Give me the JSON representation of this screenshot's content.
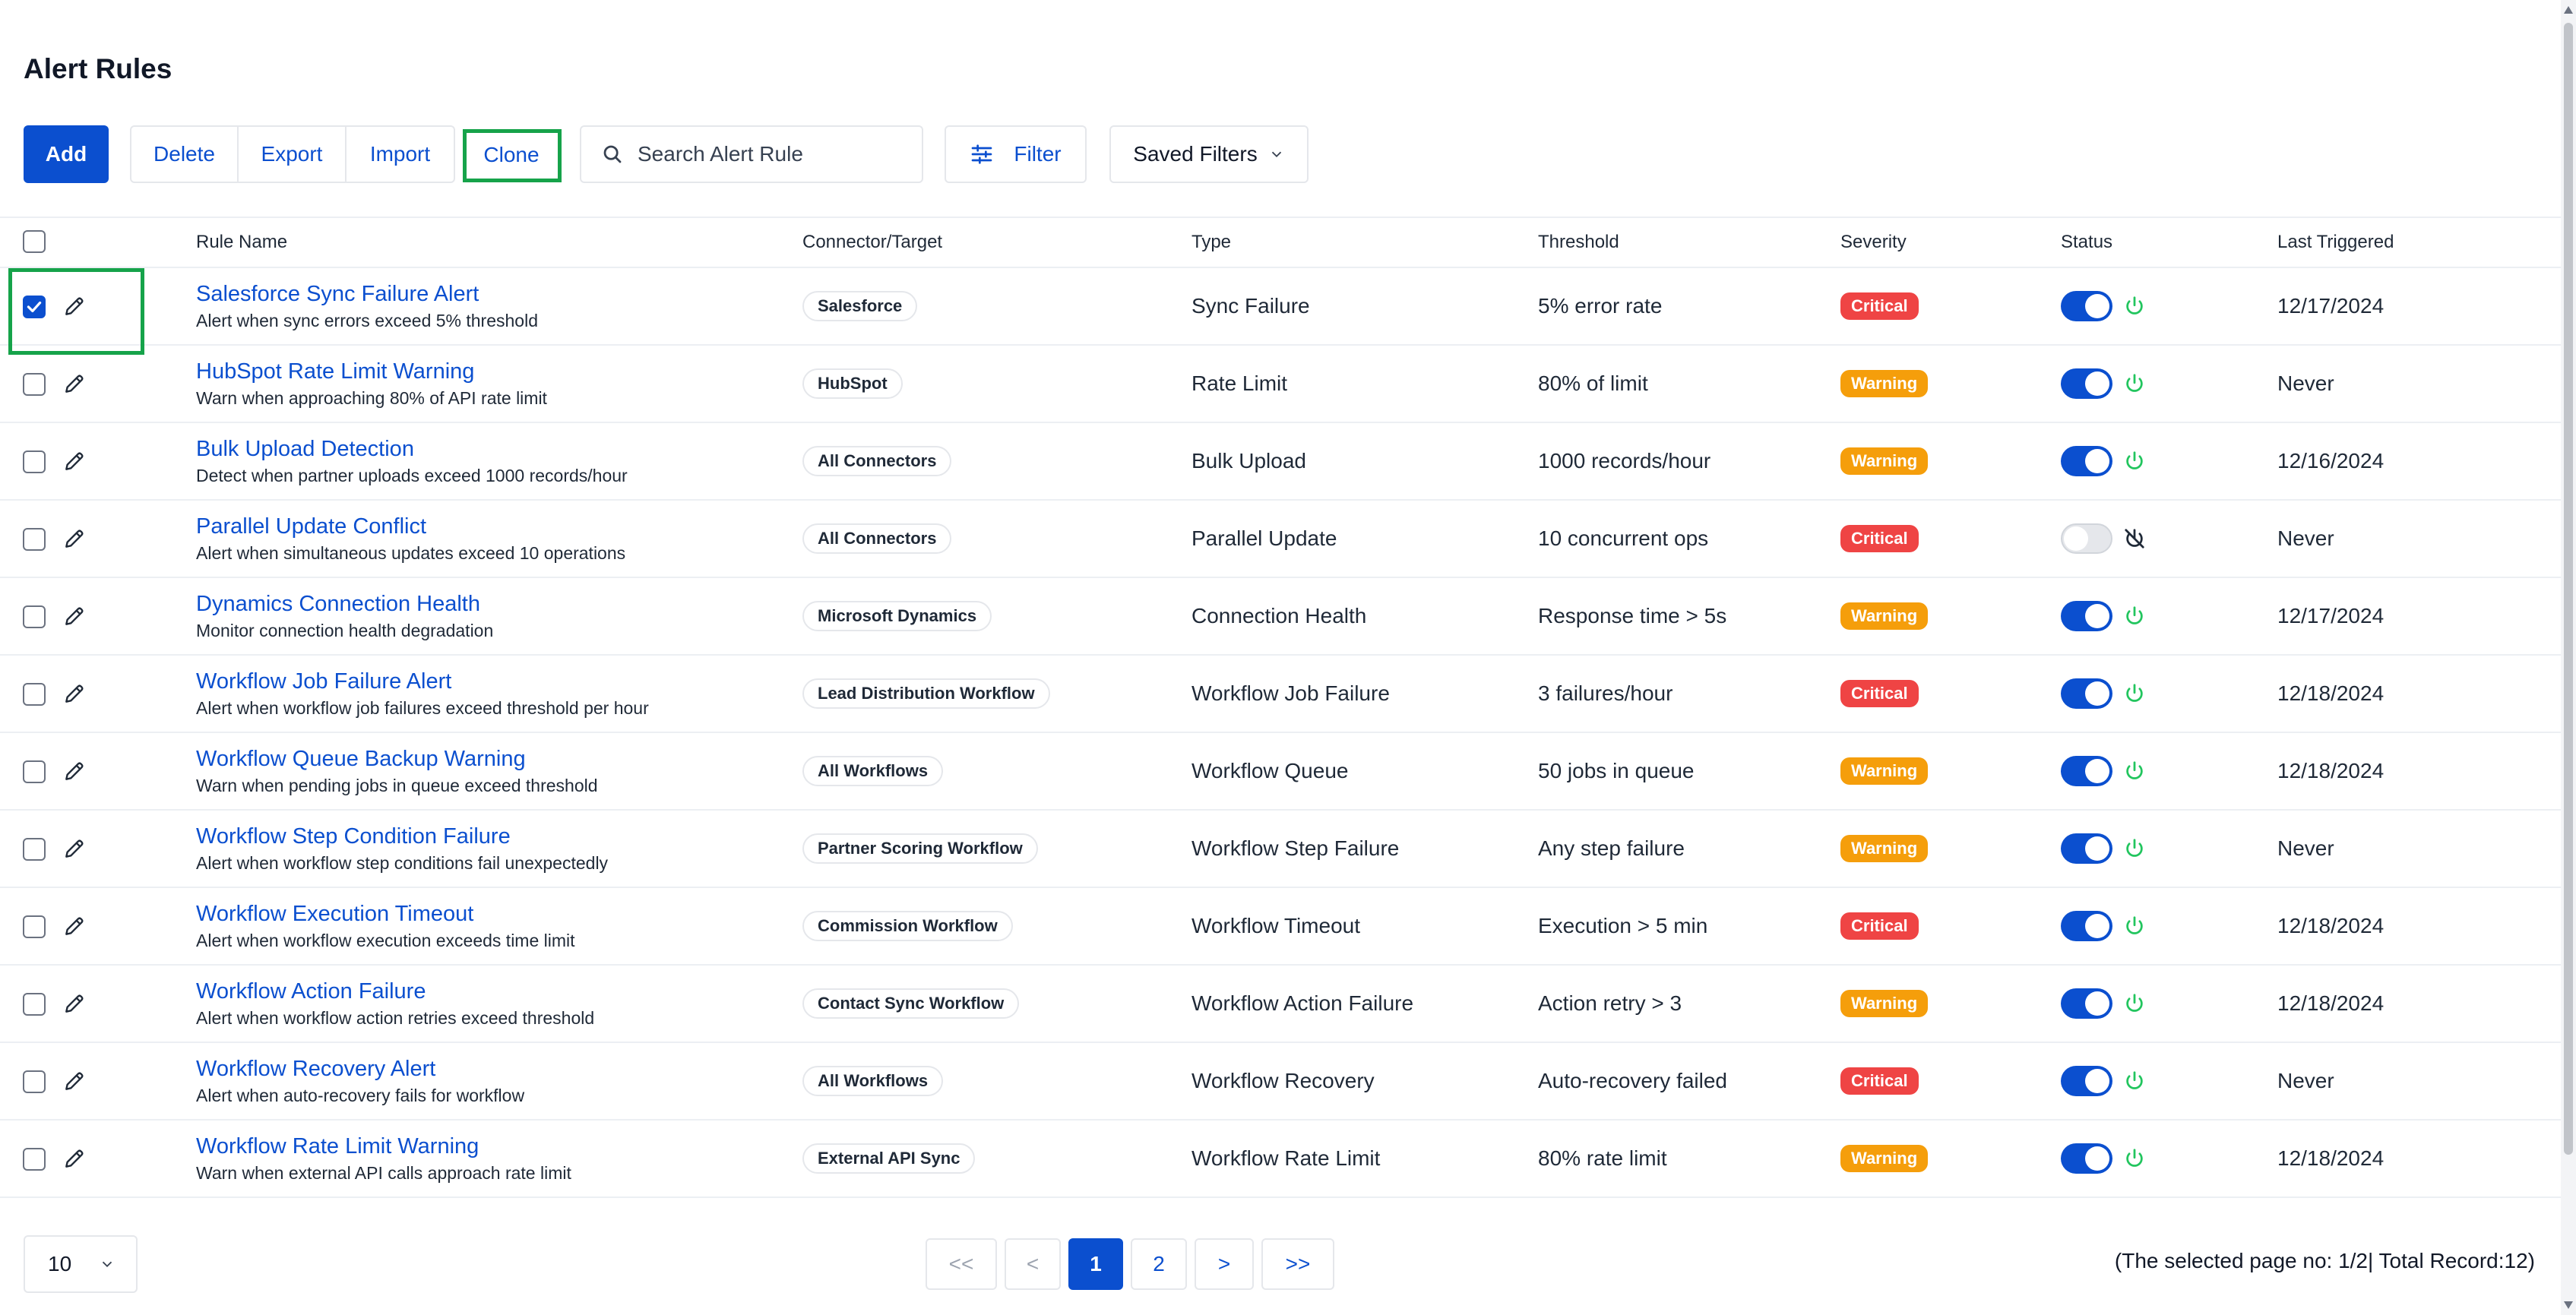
{
  "page": {
    "title": "Alert Rules"
  },
  "toolbar": {
    "add_label": "Add",
    "delete_label": "Delete",
    "export_label": "Export",
    "import_label": "Import",
    "clone_label": "Clone",
    "search_placeholder": "Search Alert Rule",
    "filter_label": "Filter",
    "saved_filters_label": "Saved Filters"
  },
  "table": {
    "columns": [
      "Rule Name",
      "Connector/Target",
      "Type",
      "Threshold",
      "Severity",
      "Status",
      "Last Triggered"
    ],
    "rows": [
      {
        "name": "Salesforce Sync Failure Alert",
        "description": "Alert when sync errors exceed 5% threshold",
        "connector": "Salesforce",
        "type": "Sync Failure",
        "threshold": "5% error rate",
        "severity": "Critical",
        "status_on": true,
        "last_triggered": "12/17/2024",
        "checked": true
      },
      {
        "name": "HubSpot Rate Limit Warning",
        "description": "Warn when approaching 80% of API rate limit",
        "connector": "HubSpot",
        "type": "Rate Limit",
        "threshold": "80% of limit",
        "severity": "Warning",
        "status_on": true,
        "last_triggered": "Never",
        "checked": false
      },
      {
        "name": "Bulk Upload Detection",
        "description": "Detect when partner uploads exceed 1000 records/hour",
        "connector": "All Connectors",
        "type": "Bulk Upload",
        "threshold": "1000 records/hour",
        "severity": "Warning",
        "status_on": true,
        "last_triggered": "12/16/2024",
        "checked": false
      },
      {
        "name": "Parallel Update Conflict",
        "description": "Alert when simultaneous updates exceed 10 operations",
        "connector": "All Connectors",
        "type": "Parallel Update",
        "threshold": "10 concurrent ops",
        "severity": "Critical",
        "status_on": false,
        "last_triggered": "Never",
        "checked": false
      },
      {
        "name": "Dynamics Connection Health",
        "description": "Monitor connection health degradation",
        "connector": "Microsoft Dynamics",
        "type": "Connection Health",
        "threshold": "Response time > 5s",
        "severity": "Warning",
        "status_on": true,
        "last_triggered": "12/17/2024",
        "checked": false
      },
      {
        "name": "Workflow Job Failure Alert",
        "description": "Alert when workflow job failures exceed threshold per hour",
        "connector": "Lead Distribution Workflow",
        "type": "Workflow Job Failure",
        "threshold": "3 failures/hour",
        "severity": "Critical",
        "status_on": true,
        "last_triggered": "12/18/2024",
        "checked": false
      },
      {
        "name": "Workflow Queue Backup Warning",
        "description": "Warn when pending jobs in queue exceed threshold",
        "connector": "All Workflows",
        "type": "Workflow Queue",
        "threshold": "50 jobs in queue",
        "severity": "Warning",
        "status_on": true,
        "last_triggered": "12/18/2024",
        "checked": false
      },
      {
        "name": "Workflow Step Condition Failure",
        "description": "Alert when workflow step conditions fail unexpectedly",
        "connector": "Partner Scoring Workflow",
        "type": "Workflow Step Failure",
        "threshold": "Any step failure",
        "severity": "Warning",
        "status_on": true,
        "last_triggered": "Never",
        "checked": false
      },
      {
        "name": "Workflow Execution Timeout",
        "description": "Alert when workflow execution exceeds time limit",
        "connector": "Commission Workflow",
        "type": "Workflow Timeout",
        "threshold": "Execution > 5 min",
        "severity": "Critical",
        "status_on": true,
        "last_triggered": "12/18/2024",
        "checked": false
      },
      {
        "name": "Workflow Action Failure",
        "description": "Alert when workflow action retries exceed threshold",
        "connector": "Contact Sync Workflow",
        "type": "Workflow Action Failure",
        "threshold": "Action retry > 3",
        "severity": "Warning",
        "status_on": true,
        "last_triggered": "12/18/2024",
        "checked": false
      },
      {
        "name": "Workflow Recovery Alert",
        "description": "Alert when auto-recovery fails for workflow",
        "connector": "All Workflows",
        "type": "Workflow Recovery",
        "threshold": "Auto-recovery failed",
        "severity": "Critical",
        "status_on": true,
        "last_triggered": "Never",
        "checked": false
      },
      {
        "name": "Workflow Rate Limit Warning",
        "description": "Warn when external API calls approach rate limit",
        "connector": "External API Sync",
        "type": "Workflow Rate Limit",
        "threshold": "80% rate limit",
        "severity": "Warning",
        "status_on": true,
        "last_triggered": "12/18/2024",
        "checked": false
      }
    ]
  },
  "pagination": {
    "page_size": "10",
    "first_label": "<<",
    "prev_label": "<",
    "pages": [
      "1",
      "2"
    ],
    "current_page": "1",
    "next_label": ">",
    "last_label": ">>",
    "info": "(The selected page no: 1/2| Total Record:12)"
  },
  "colors": {
    "primary": "#0b4fcf",
    "critical": "#ef4444",
    "warning": "#f59e0b",
    "highlight": "#16a34a",
    "power_on": "#22c55e"
  }
}
